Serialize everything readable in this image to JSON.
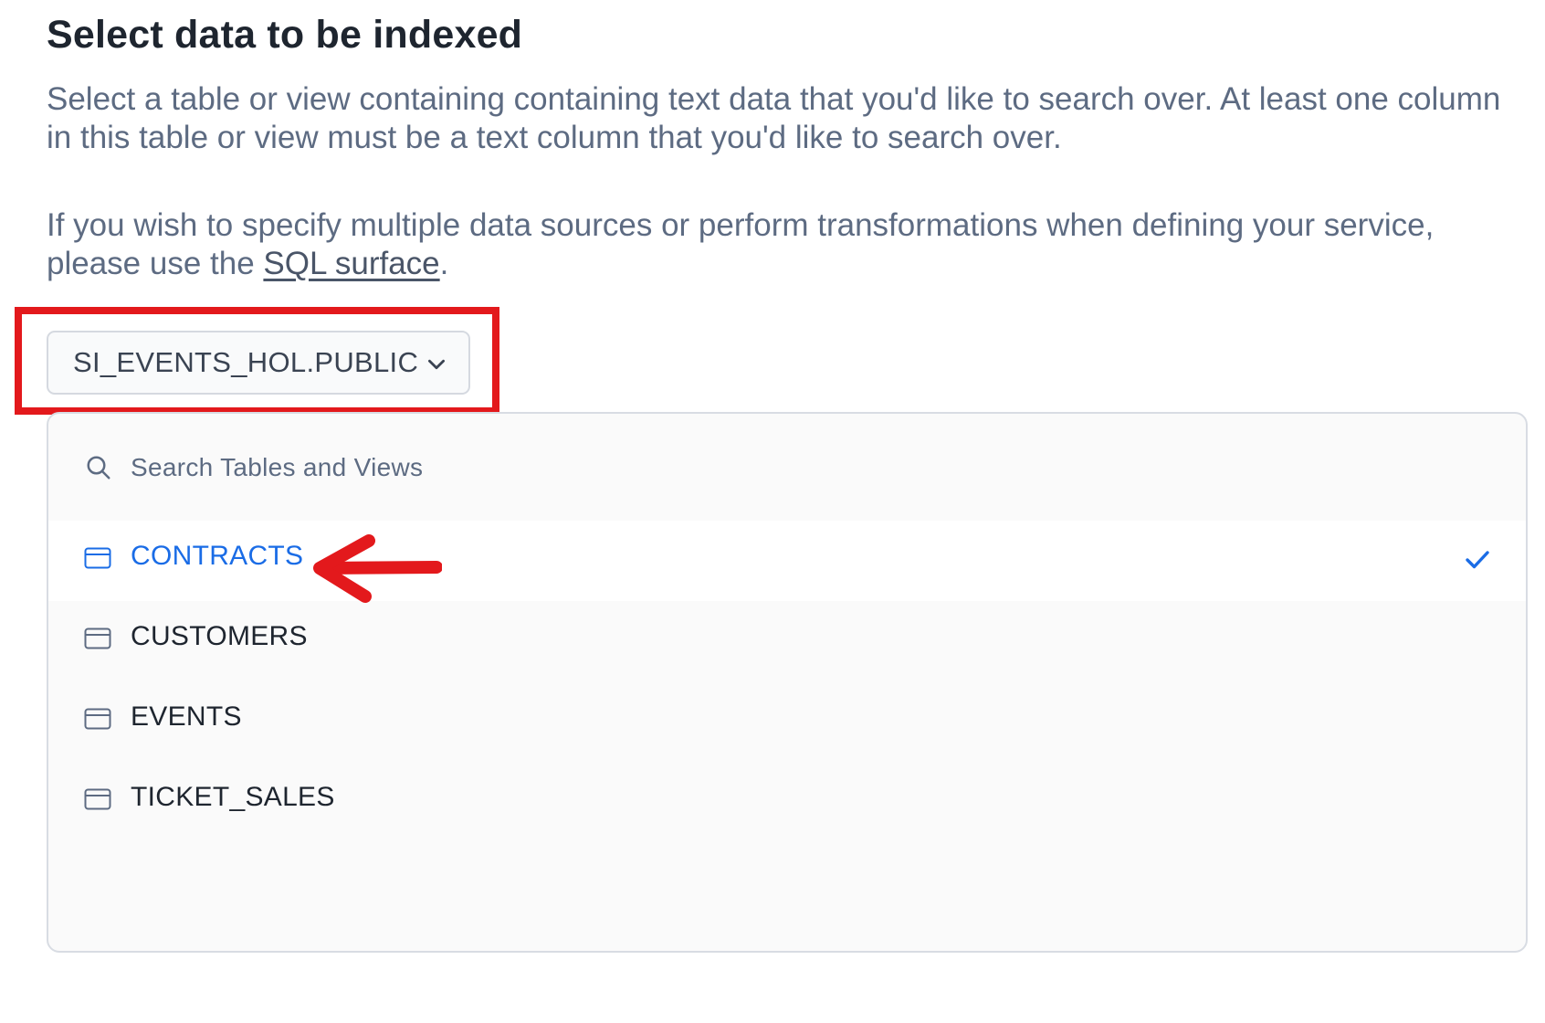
{
  "page": {
    "title": "Select data to be indexed",
    "description": "Select a table or view containing containing text data that you'd like to search over. At least one column in this table or view must be a text column that you'd like to search over.",
    "note_prefix": "If you wish to specify multiple data sources or perform transformations when defining your service, please use the ",
    "note_link": "SQL surface",
    "note_suffix": "."
  },
  "schema_select": {
    "value": "SI_EVENTS_HOL.PUBLIC",
    "icon": "chevron-down-icon"
  },
  "dropdown": {
    "search_placeholder": "Search Tables and Views",
    "search_value": "",
    "items": [
      {
        "label": "CONTRACTS",
        "icon": "table-icon",
        "selected": true
      },
      {
        "label": "CUSTOMERS",
        "icon": "table-icon",
        "selected": false
      },
      {
        "label": "EVENTS",
        "icon": "table-icon",
        "selected": false
      },
      {
        "label": "TICKET_SALES",
        "icon": "table-icon",
        "selected": false
      }
    ]
  },
  "annotations": {
    "highlight_color": "#e3191c",
    "arrow_target": "CONTRACTS"
  },
  "colors": {
    "accent": "#1a6ce6",
    "heading": "#1e252f",
    "body_text": "#5d6b82"
  }
}
